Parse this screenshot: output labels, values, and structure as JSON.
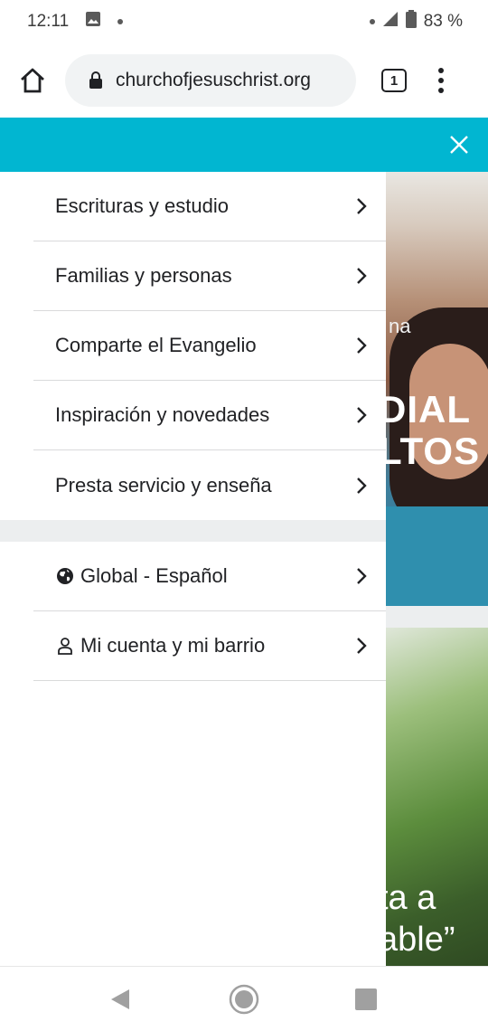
{
  "status_bar": {
    "time": "12:11",
    "battery": "83 %"
  },
  "browser": {
    "url": "churchofjesuschrist.org",
    "tab_count": "1"
  },
  "background": {
    "hero_label": "na",
    "hero_title_line1": "DIAL",
    "hero_title_line2": "LTOS",
    "forest_line1": "ta a",
    "forest_line2": "able”"
  },
  "drawer": {
    "primary_items": [
      {
        "label": "Escrituras y estudio"
      },
      {
        "label": "Familias y personas"
      },
      {
        "label": "Comparte el Evangelio"
      },
      {
        "label": "Inspiración y novedades"
      },
      {
        "label": "Presta servicio y enseña"
      }
    ],
    "secondary_items": [
      {
        "label": "Global - Español",
        "icon": "globe-icon"
      },
      {
        "label": "Mi cuenta y mi barrio",
        "icon": "person-icon"
      }
    ]
  },
  "colors": {
    "header_teal": "#01b6d1",
    "band_gray": "#eceeef"
  }
}
